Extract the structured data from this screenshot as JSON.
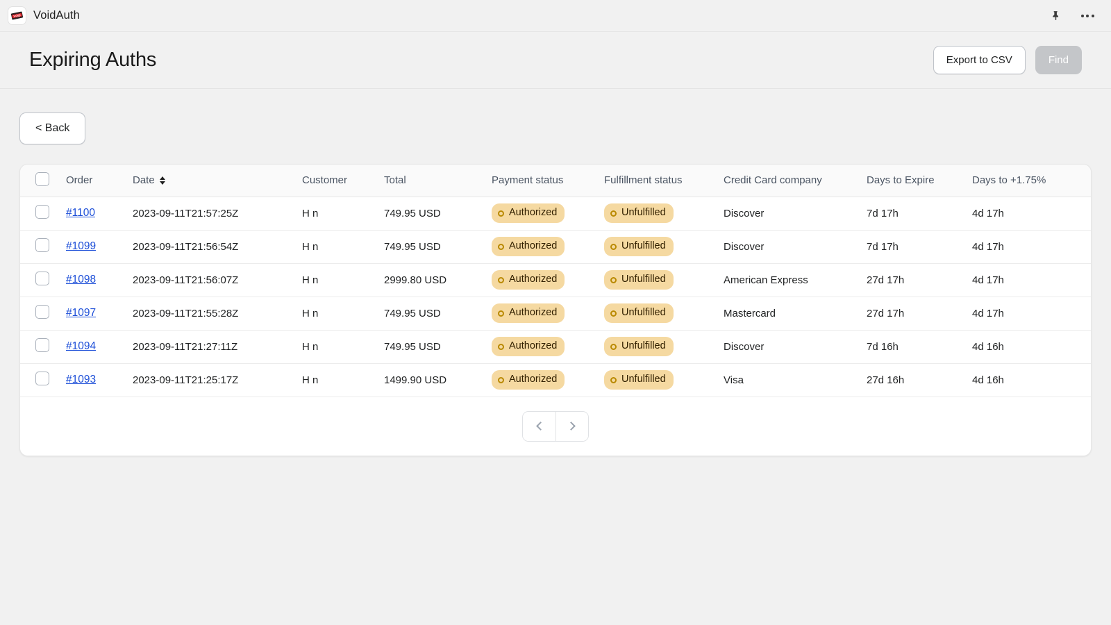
{
  "appbar": {
    "title": "VoidAuth",
    "icon_name": "void-stamp-icon",
    "pin_icon": "pushpin-icon",
    "more_icon": "more-horizontal-icon"
  },
  "header": {
    "title": "Expiring Auths",
    "export_label": "Export to CSV",
    "find_label": "Find"
  },
  "toolbar": {
    "back_label": "< Back"
  },
  "table": {
    "columns": [
      {
        "key": "select",
        "label": ""
      },
      {
        "key": "order",
        "label": "Order"
      },
      {
        "key": "date",
        "label": "Date",
        "sortable": true
      },
      {
        "key": "customer",
        "label": "Customer"
      },
      {
        "key": "total",
        "label": "Total"
      },
      {
        "key": "payment_status",
        "label": "Payment status"
      },
      {
        "key": "fulfillment_status",
        "label": "Fulfillment status"
      },
      {
        "key": "credit_card_company",
        "label": "Credit Card company"
      },
      {
        "key": "days_to_expire",
        "label": "Days to Expire"
      },
      {
        "key": "days_to_increment",
        "label": "Days to +1.75%"
      }
    ],
    "rows": [
      {
        "order": "#1100",
        "date": "2023-09-11T21:57:25Z",
        "customer": "H n",
        "total": "749.95 USD",
        "payment_status": "Authorized",
        "fulfillment_status": "Unfulfilled",
        "credit_card_company": "Discover",
        "days_to_expire": "7d 17h",
        "days_to_increment": "4d 17h"
      },
      {
        "order": "#1099",
        "date": "2023-09-11T21:56:54Z",
        "customer": "H n",
        "total": "749.95 USD",
        "payment_status": "Authorized",
        "fulfillment_status": "Unfulfilled",
        "credit_card_company": "Discover",
        "days_to_expire": "7d 17h",
        "days_to_increment": "4d 17h"
      },
      {
        "order": "#1098",
        "date": "2023-09-11T21:56:07Z",
        "customer": "H n",
        "total": "2999.80 USD",
        "payment_status": "Authorized",
        "fulfillment_status": "Unfulfilled",
        "credit_card_company": "American Express",
        "days_to_expire": "27d 17h",
        "days_to_increment": "4d 17h"
      },
      {
        "order": "#1097",
        "date": "2023-09-11T21:55:28Z",
        "customer": "H n",
        "total": "749.95 USD",
        "payment_status": "Authorized",
        "fulfillment_status": "Unfulfilled",
        "credit_card_company": "Mastercard",
        "days_to_expire": "27d 17h",
        "days_to_increment": "4d 17h"
      },
      {
        "order": "#1094",
        "date": "2023-09-11T21:27:11Z",
        "customer": "H n",
        "total": "749.95 USD",
        "payment_status": "Authorized",
        "fulfillment_status": "Unfulfilled",
        "credit_card_company": "Discover",
        "days_to_expire": "7d 16h",
        "days_to_increment": "4d 16h"
      },
      {
        "order": "#1093",
        "date": "2023-09-11T21:25:17Z",
        "customer": "H n",
        "total": "1499.90 USD",
        "payment_status": "Authorized",
        "fulfillment_status": "Unfulfilled",
        "credit_card_company": "Visa",
        "days_to_expire": "27d 16h",
        "days_to_increment": "4d 16h"
      }
    ]
  },
  "pagination": {
    "prev_icon": "chevron-left-icon",
    "next_icon": "chevron-right-icon"
  },
  "colors": {
    "page_background": "#f1f1f1",
    "card_background": "#ffffff",
    "link": "#1c4ed8",
    "badge_background": "#f5d9a1",
    "badge_accent": "#b98900",
    "disabled_button": "#c4c6c9"
  }
}
